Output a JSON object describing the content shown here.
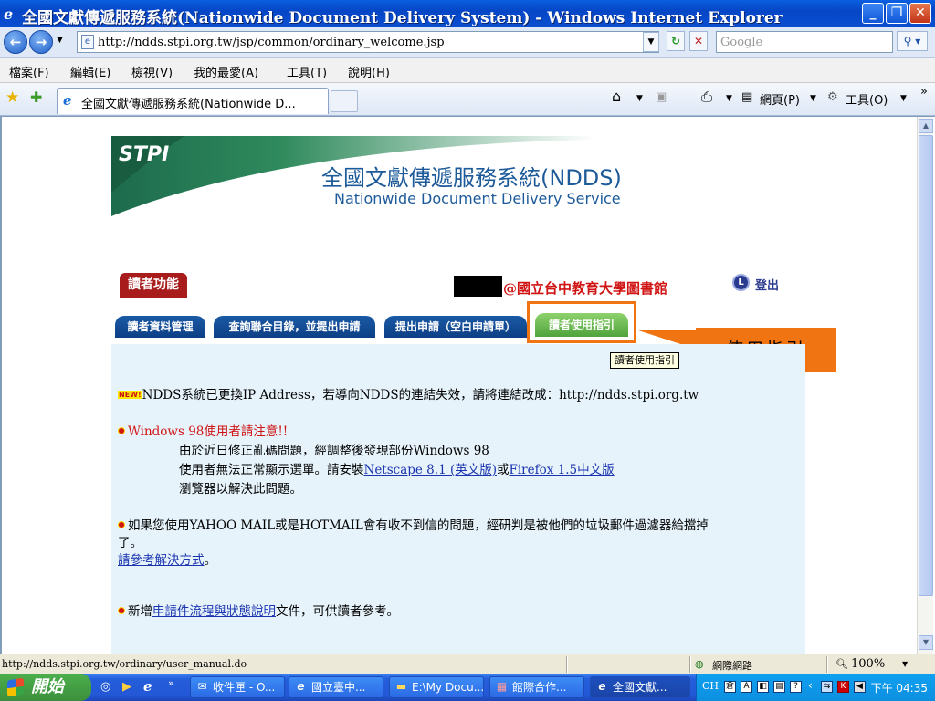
{
  "window": {
    "title": "全國文獻傳遞服務系統(Nationwide Document Delivery System) - Windows Internet Explorer",
    "min": "_",
    "max": "❐",
    "close": "✕"
  },
  "address_bar": {
    "back": "←",
    "forward": "→",
    "url": "http://ndds.stpi.org.tw/jsp/common/ordinary_welcome.jsp",
    "search_placeholder": "Google"
  },
  "menu": [
    "檔案(F)",
    "編輯(E)",
    "檢視(V)",
    "我的最愛(A)",
    "工具(T)",
    "說明(H)"
  ],
  "tab": {
    "label": "全國文獻傳遞服務系統(Nationwide D..."
  },
  "command_bar": {
    "page_label": "網頁(P)",
    "tools_label": "工具(O)"
  },
  "site": {
    "logo": "STPI",
    "title_zh": "全國文獻傳遞服務系統(NDDS)",
    "title_en": "Nationwide Document Delivery Service",
    "reader_functions": "讀者功能",
    "library": "@國立台中教育大學圖書館",
    "logout": "登出",
    "logout_icon": "L",
    "tabs": [
      "讀者資料管理",
      "查詢聯合目錄，並提出申請",
      "提出申請（空白申請單）",
      "讀者使用指引"
    ],
    "callout": "使用指引",
    "tooltip": "讀者使用指引"
  },
  "notices": {
    "new_badge": "NEW!",
    "ip_notice": "NDDS系統已更換IP Address，若導向NDDS的連結失效，請將連結改成：http://ndds.stpi.org.tw",
    "win98_title": "Windows 98使用者請注意!!",
    "win98_line1": "由於近日修正亂碼問題，經調整後發現部份Windows 98",
    "win98_line2_prefix": "使用者無法正常顯示選單。請安裝",
    "netscape_link": "Netscape 8.1 (英文版)",
    "or": "或",
    "firefox_link": "Firefox 1.5中文版",
    "win98_line3": "瀏覽器以解決此問題。",
    "yahoo_line1": "如果您使用YAHOO MAIL或是HOTMAIL會有收不到信的問題，經研判是被他們的垃圾郵件過濾器給擋掉",
    "yahoo_line2": "了。",
    "solution_link": "請參考解決方式",
    "solution_suffix": "。",
    "new_doc_prefix": "新增",
    "new_doc_link": "申請件流程與狀態說明",
    "new_doc_suffix": "文件，可供讀者參考。"
  },
  "status_bar": {
    "url": "http://ndds.stpi.org.tw/ordinary/user_manual.do",
    "zone": "網際網路",
    "zoom": "100%"
  },
  "taskbar": {
    "start": "開始",
    "items": [
      "收件匣 - O...",
      "國立臺中...",
      "E:\\My Docu...",
      "館際合作...",
      "全國文獻..."
    ],
    "lang": "CH",
    "clock": "下午 04:35"
  }
}
